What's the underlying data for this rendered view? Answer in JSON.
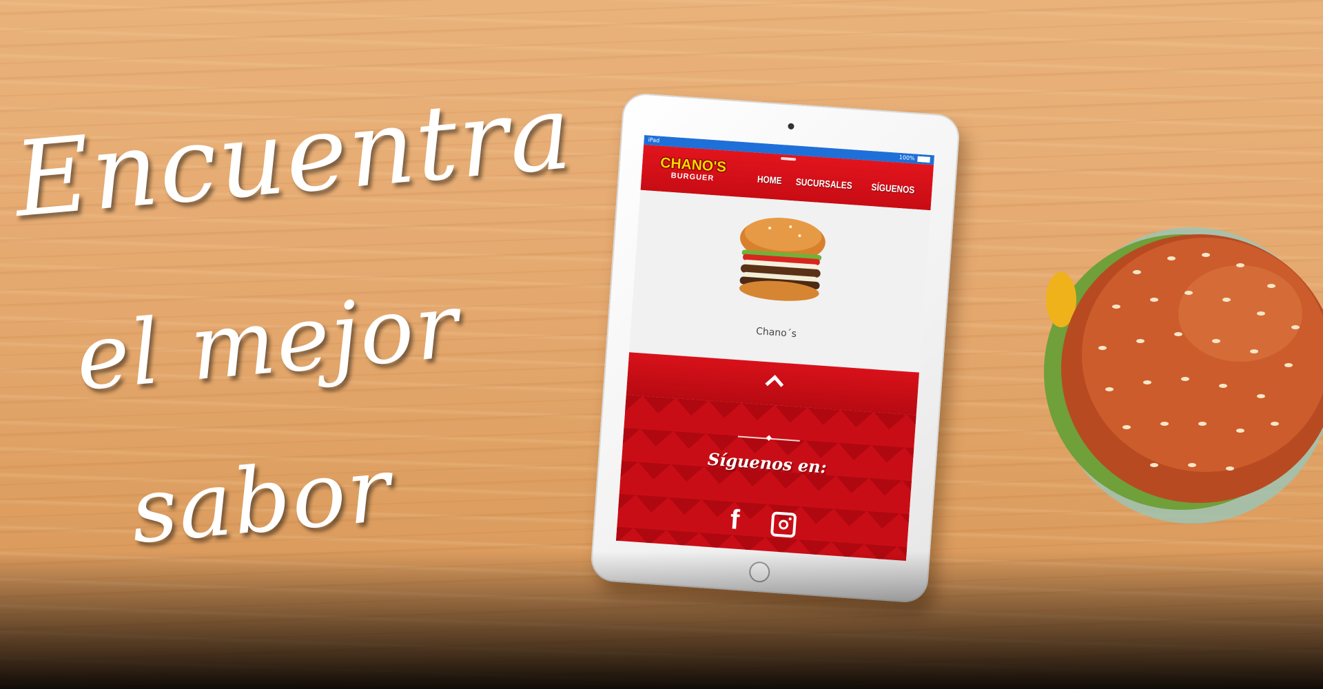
{
  "slogan": {
    "line1": "Encuentra",
    "line2": "el mejor",
    "line3": "sabor"
  },
  "tablet": {
    "status_bar": {
      "carrier": "iPad",
      "battery": "100%"
    },
    "site": {
      "logo_main": "CHANO'S",
      "logo_sub": "BURGUER",
      "nav": [
        "HOME",
        "SUCURSALES",
        "SÍGUENOS"
      ],
      "hero_caption": "Chano´s",
      "follow_title": "Síguenos en:",
      "facebook_glyph": "f"
    },
    "colors": {
      "brand_red": "#e2141d",
      "logo_yellow": "#ffd400",
      "status_blue": "#1f6fd8"
    }
  },
  "icons": [
    "chevron-up-icon",
    "facebook-icon",
    "instagram-icon",
    "camera-icon",
    "home-button-icon",
    "battery-icon"
  ]
}
